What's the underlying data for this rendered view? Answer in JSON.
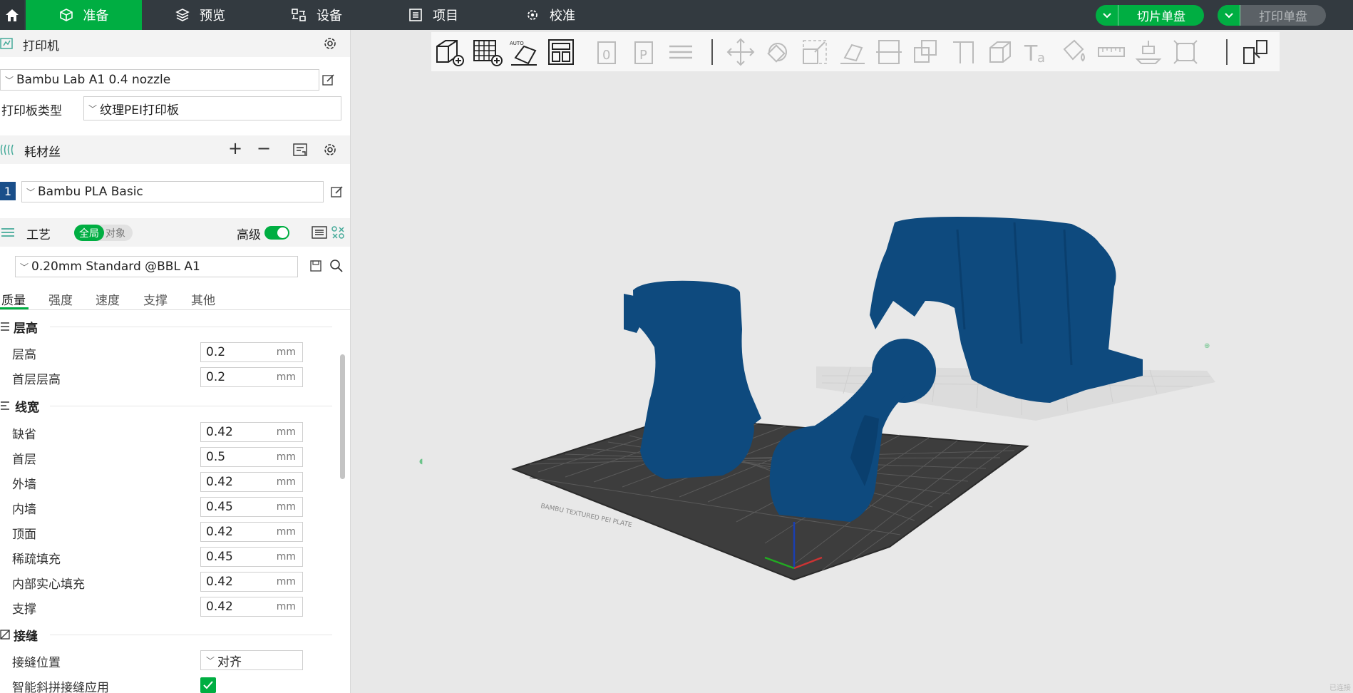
{
  "app": {
    "tabs": [
      {
        "label": "准备",
        "icon": "cube-icon",
        "active": true
      },
      {
        "label": "预览",
        "icon": "layers-icon",
        "active": false
      },
      {
        "label": "设备",
        "icon": "device-icon",
        "active": false
      },
      {
        "label": "项目",
        "icon": "list-icon",
        "active": false
      },
      {
        "label": "校准",
        "icon": "calibrate-icon",
        "active": false
      }
    ],
    "slice_label": "切片单盘",
    "print_label": "打印单盘",
    "accent": "#00ae42",
    "topbar_color": "#333a40"
  },
  "printer": {
    "title": "打印机",
    "model": "Bambu Lab A1 0.4 nozzle",
    "plate_label": "打印板类型",
    "plate_value": "纹理PEI打印板"
  },
  "filament": {
    "title": "耗材丝",
    "slot_number": "1",
    "value": "Bambu PLA Basic",
    "slot_color": "#1a4f8a"
  },
  "process": {
    "title": "工艺",
    "toggle_global": "全局",
    "toggle_object": "对象",
    "advanced_label": "高级",
    "advanced_on": true,
    "profile": "0.20mm Standard @BBL A1",
    "tabs": [
      "质量",
      "强度",
      "速度",
      "支撑",
      "其他"
    ],
    "active_tab": "质量",
    "groups": {
      "layer_height": {
        "title": "层高",
        "params": [
          {
            "label": "层高",
            "value": "0.2",
            "unit": "mm"
          },
          {
            "label": "首层层高",
            "value": "0.2",
            "unit": "mm"
          }
        ]
      },
      "line_width": {
        "title": "线宽",
        "params": [
          {
            "label": "缺省",
            "value": "0.42",
            "unit": "mm"
          },
          {
            "label": "首层",
            "value": "0.5",
            "unit": "mm"
          },
          {
            "label": "外墙",
            "value": "0.42",
            "unit": "mm"
          },
          {
            "label": "内墙",
            "value": "0.45",
            "unit": "mm"
          },
          {
            "label": "顶面",
            "value": "0.42",
            "unit": "mm"
          },
          {
            "label": "稀疏填充",
            "value": "0.45",
            "unit": "mm"
          },
          {
            "label": "内部实心填充",
            "value": "0.42",
            "unit": "mm"
          },
          {
            "label": "支撑",
            "value": "0.42",
            "unit": "mm"
          }
        ]
      },
      "seam": {
        "title": "接缝",
        "position_label": "接缝位置",
        "position_value": "对齐",
        "smart_scarf_label": "智能斜拼接缝应用",
        "smart_scarf_checked": true
      }
    }
  },
  "scene": {
    "model_color": "#0e4a7e",
    "plate_color": "#3b3b3b",
    "corner_text": "已连接"
  }
}
